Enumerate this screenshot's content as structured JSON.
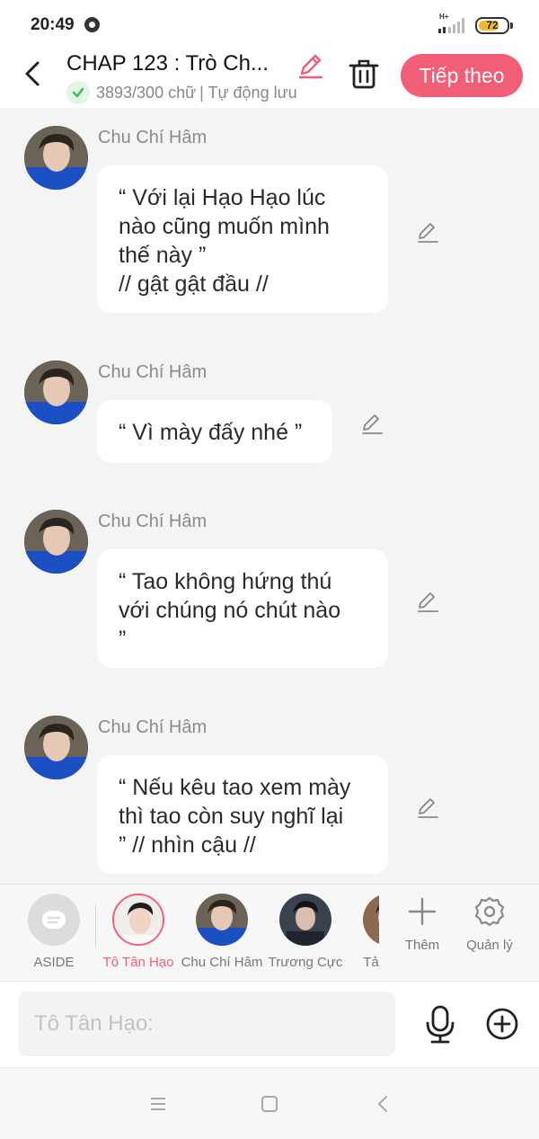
{
  "status_bar": {
    "time": "20:49",
    "network": "H+",
    "battery": "72",
    "battery_level": 0.72,
    "battery_color": "#f5b829"
  },
  "header": {
    "title": "CHAP 123 : Trò Ch...",
    "word_count": "3893/300 chữ",
    "autosave": "| Tự động lưu",
    "next_label": "Tiếp theo",
    "accent": "#f25d78",
    "icons": {
      "back": "chevron-left-icon",
      "edit": "pencil-icon",
      "delete": "trash-icon",
      "check": "check-icon"
    }
  },
  "messages": [
    {
      "sender": "Chu Chí Hâm",
      "text": "“ Với lại Hạo Hạo lúc\nnào cũng muốn mình\nthế này ”\n // gật gật đầu //"
    },
    {
      "sender": "Chu Chí Hâm",
      "text": "“ Vì mày đấy nhé ”"
    },
    {
      "sender": "Chu Chí Hâm",
      "text": "“ Tao không hứng thú\nvới chúng nó chút nào\n”"
    },
    {
      "sender": "Chu Chí Hâm",
      "text": "“ Nếu kêu tao xem mày\nthì tao còn suy nghĩ lại\n” // nhìn cậu //"
    }
  ],
  "characters": [
    {
      "label": "ASIDE"
    },
    {
      "label": "Tô Tân Hạo",
      "selected": true
    },
    {
      "label": "Chu Chí Hâm"
    },
    {
      "label": "Trương Cực"
    },
    {
      "label": "Tả Hàng"
    }
  ],
  "tools": {
    "add_label": "Thêm",
    "manage_label": "Quản lý"
  },
  "input": {
    "placeholder": "Tô Tân Hạo:",
    "value": ""
  },
  "nav": {
    "icons": [
      "menu-icon",
      "home-square-icon",
      "back-triangle-icon"
    ]
  }
}
